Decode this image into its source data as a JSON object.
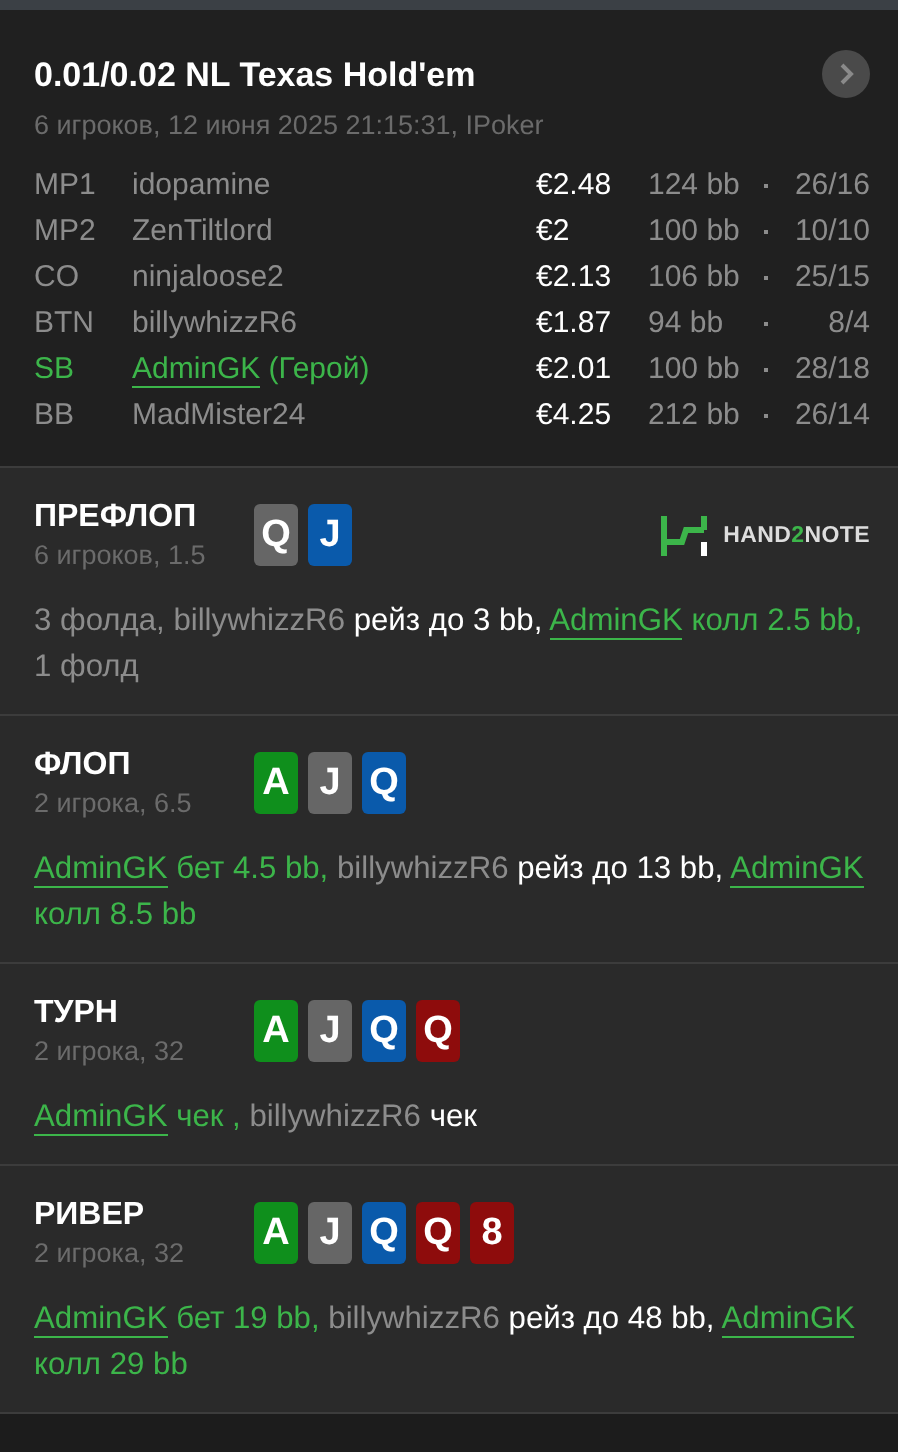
{
  "hand": {
    "title": "0.01/0.02 NL Texas Hold'em",
    "subtitle": "6 игроков, 12 июня 2025 21:15:31, IPoker",
    "players": [
      {
        "position": "MP1",
        "name": "idopamine",
        "hero": false,
        "stack": "€2.48",
        "bb": "124 bb",
        "stats": "26/16"
      },
      {
        "position": "MP2",
        "name": "ZenTiltlord",
        "hero": false,
        "stack": "€2",
        "bb": "100 bb",
        "stats": "10/10"
      },
      {
        "position": "CO",
        "name": "ninjaloose2",
        "hero": false,
        "stack": "€2.13",
        "bb": "106 bb",
        "stats": "25/15"
      },
      {
        "position": "BTN",
        "name": "billywhizzR6",
        "hero": false,
        "stack": "€1.87",
        "bb": "94 bb",
        "stats": "8/4"
      },
      {
        "position": "SB",
        "name": "AdminGK",
        "hero": true,
        "hero_tag": "(Герой)",
        "stack": "€2.01",
        "bb": "100 bb",
        "stats": "28/18"
      },
      {
        "position": "BB",
        "name": "MadMister24",
        "hero": false,
        "stack": "€4.25",
        "bb": "212 bb",
        "stats": "26/14"
      }
    ]
  },
  "logo": [
    {
      "text": "HAND",
      "accent": false
    },
    {
      "text": "2",
      "accent": true
    },
    {
      "text": "NOTE",
      "accent": false
    }
  ],
  "streets": [
    {
      "name": "ПРЕФЛОП",
      "info": "6 игроков, 1.5",
      "logo": true,
      "cards": [
        {
          "rank": "Q",
          "color": "#666666"
        },
        {
          "rank": "J",
          "color": "#0a5aab"
        }
      ],
      "actions": [
        {
          "kind": "plain",
          "text": "3 фолда, "
        },
        {
          "kind": "player",
          "text": "billywhizzR6"
        },
        {
          "kind": "action",
          "text": " рейз до 3 bb, "
        },
        {
          "kind": "hero",
          "text": "AdminGK"
        },
        {
          "kind": "hero_action",
          "text": " колл 2.5 bb, "
        },
        {
          "kind": "plain",
          "text": "1 фолд"
        }
      ]
    },
    {
      "name": "ФЛОП",
      "info": "2 игрока, 6.5",
      "logo": false,
      "cards": [
        {
          "rank": "A",
          "color": "#0f8f1c"
        },
        {
          "rank": "J",
          "color": "#666666"
        },
        {
          "rank": "Q",
          "color": "#0a5aab"
        }
      ],
      "actions": [
        {
          "kind": "hero",
          "text": "AdminGK"
        },
        {
          "kind": "hero_action",
          "text": " бет 4.5 bb, "
        },
        {
          "kind": "player",
          "text": "billywhizzR6"
        },
        {
          "kind": "action",
          "text": " рейз до 13 bb, "
        },
        {
          "kind": "hero",
          "text": "AdminGK"
        },
        {
          "kind": "hero_action",
          "text": " колл 8.5 bb"
        }
      ]
    },
    {
      "name": "ТУРН",
      "info": "2 игрока, 32",
      "logo": false,
      "cards": [
        {
          "rank": "A",
          "color": "#0f8f1c"
        },
        {
          "rank": "J",
          "color": "#666666"
        },
        {
          "rank": "Q",
          "color": "#0a5aab"
        },
        {
          "rank": "Q",
          "color": "#8e0c0c"
        }
      ],
      "actions": [
        {
          "kind": "hero",
          "text": "AdminGK"
        },
        {
          "kind": "hero_action",
          "text": " чек , "
        },
        {
          "kind": "player",
          "text": "billywhizzR6"
        },
        {
          "kind": "action",
          "text": " чек"
        }
      ]
    },
    {
      "name": "РИВЕР",
      "info": "2 игрока, 32",
      "logo": false,
      "cards": [
        {
          "rank": "A",
          "color": "#0f8f1c"
        },
        {
          "rank": "J",
          "color": "#666666"
        },
        {
          "rank": "Q",
          "color": "#0a5aab"
        },
        {
          "rank": "Q",
          "color": "#8e0c0c"
        },
        {
          "rank": "8",
          "color": "#8e0c0c"
        }
      ],
      "actions": [
        {
          "kind": "hero",
          "text": "AdminGK"
        },
        {
          "kind": "hero_action",
          "text": " бет 19 bb, "
        },
        {
          "kind": "player",
          "text": "billywhizzR6"
        },
        {
          "kind": "action",
          "text": " рейз до 48 bb, "
        },
        {
          "kind": "hero",
          "text": "AdminGK"
        },
        {
          "kind": "hero_action",
          "text": " колл 29 bb"
        }
      ]
    }
  ]
}
